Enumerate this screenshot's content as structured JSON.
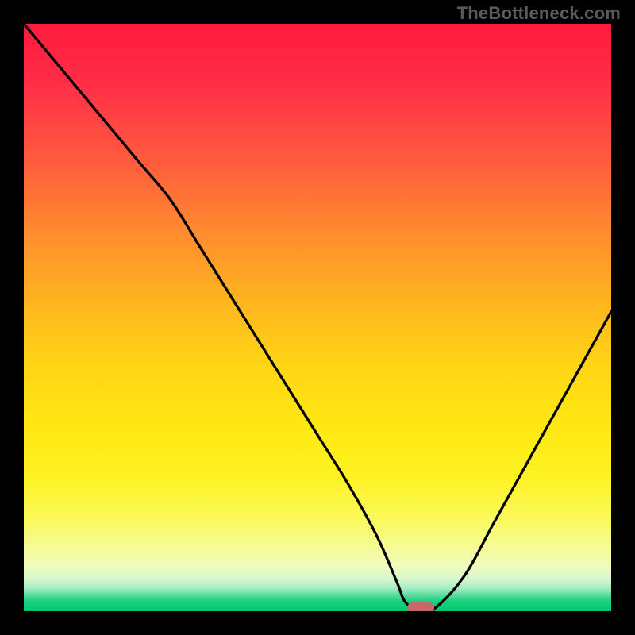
{
  "watermark": "TheBottleneck.com",
  "chart_data": {
    "type": "line",
    "title": "",
    "xlabel": "",
    "ylabel": "",
    "xlim": [
      0,
      100
    ],
    "ylim": [
      0,
      100
    ],
    "x": [
      0,
      5,
      10,
      15,
      20,
      25,
      30,
      35,
      40,
      45,
      50,
      55,
      60,
      63.5,
      65,
      67.5,
      70,
      75,
      80,
      85,
      90,
      95,
      100
    ],
    "values": [
      100,
      94,
      88,
      82,
      76,
      70,
      62,
      54,
      46,
      38,
      30,
      22,
      13,
      5,
      1.5,
      0,
      0.5,
      6,
      15,
      24,
      33,
      42,
      51
    ],
    "minimum_marker": {
      "x": 67.5,
      "y": 0
    }
  },
  "colors": {
    "curve": "#000000",
    "marker": "#c56866",
    "background_black": "#000000"
  }
}
